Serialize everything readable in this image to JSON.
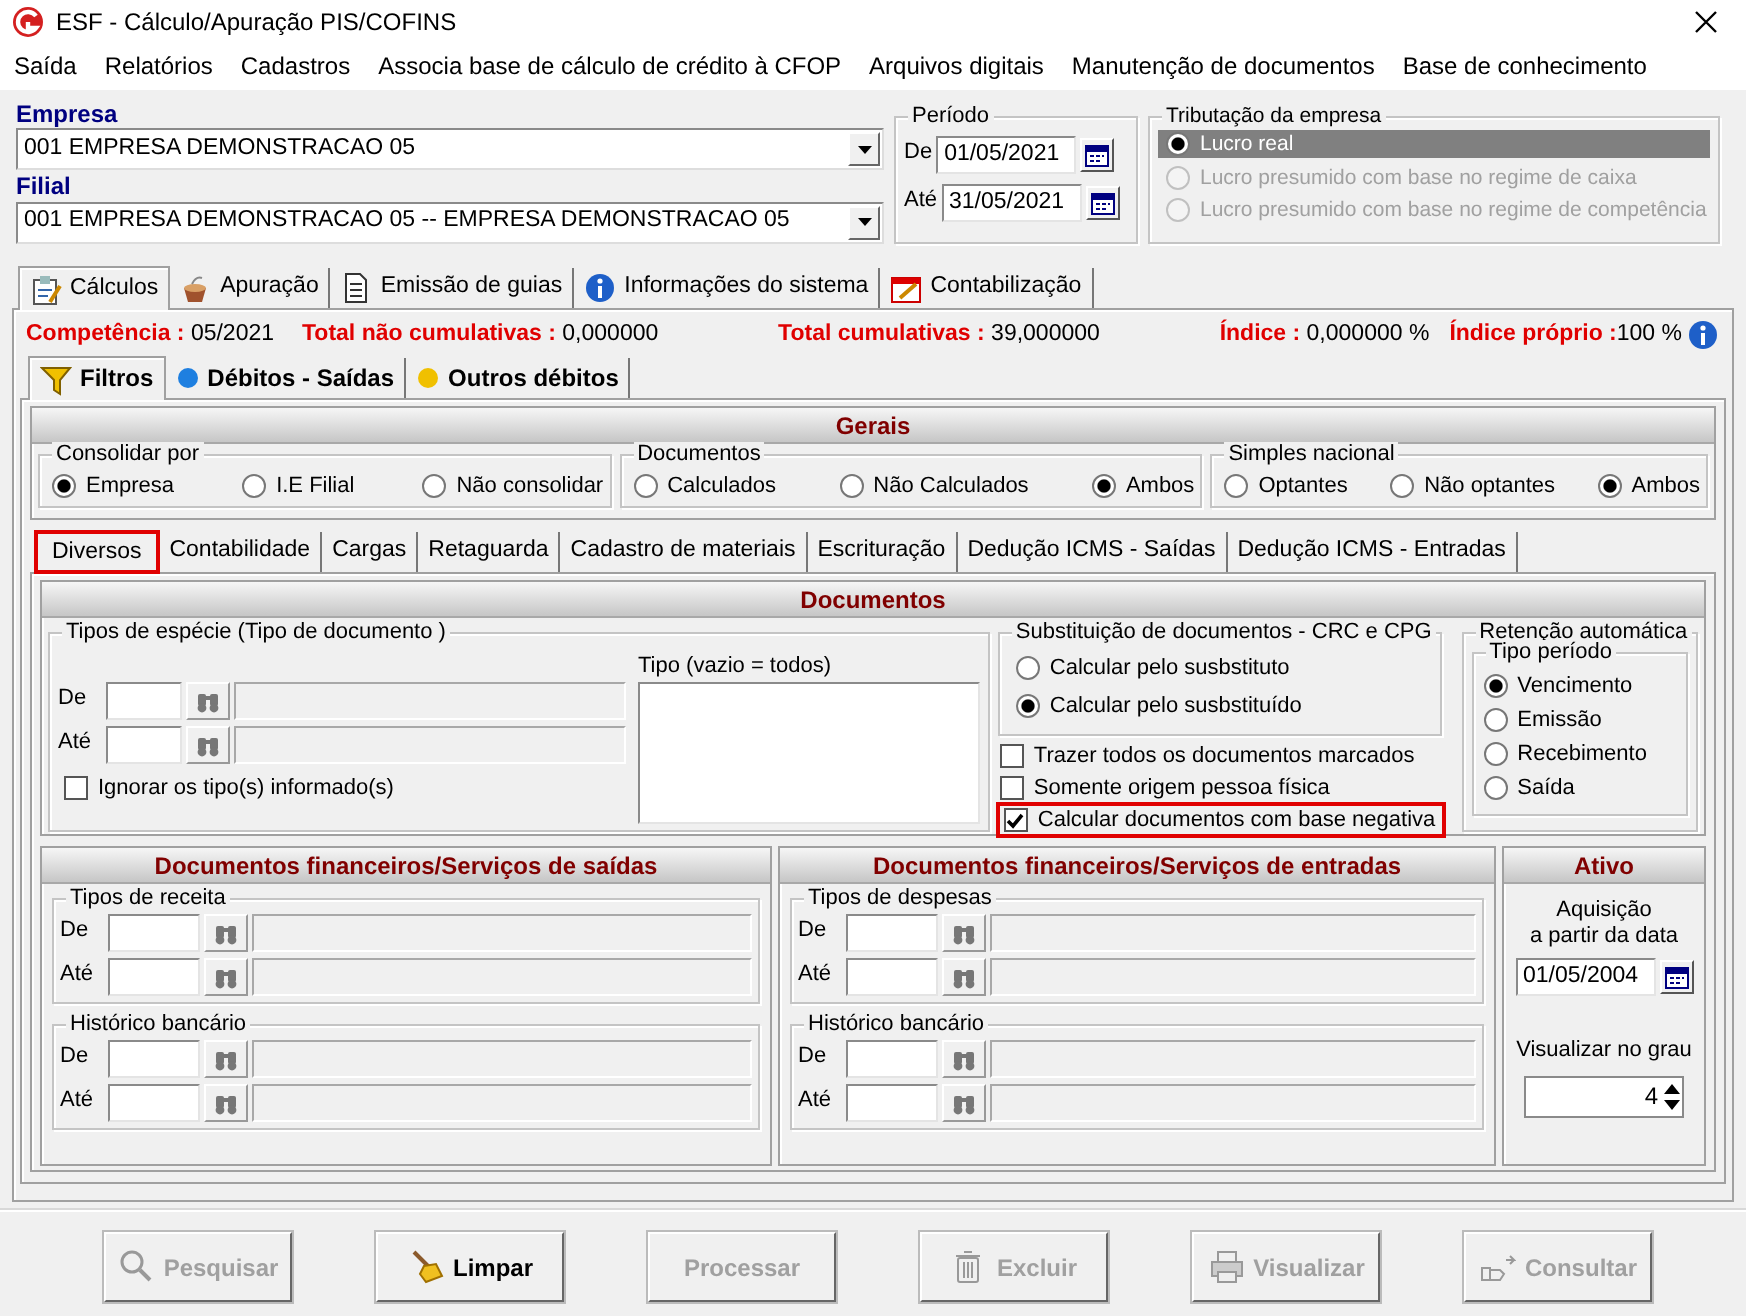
{
  "window": {
    "title": "ESF - Cálculo/Apuração PIS/COFINS"
  },
  "menu": [
    "Saída",
    "Relatórios",
    "Cadastros",
    "Associa base de cálculo de crédito à CFOP",
    "Arquivos digitais",
    "Manutenção de documentos",
    "Base de conhecimento"
  ],
  "empresa": {
    "label": "Empresa",
    "value": "001 EMPRESA DEMONSTRACAO 05"
  },
  "filial": {
    "label": "Filial",
    "value": "001 EMPRESA DEMONSTRACAO 05 -- EMPRESA DEMONSTRACAO 05"
  },
  "periodo": {
    "title": "Período",
    "fields": [
      {
        "label": "De",
        "value": "01/05/2021"
      },
      {
        "label": "Até",
        "value": "31/05/2021"
      }
    ]
  },
  "tributacao": {
    "title": "Tributação da empresa",
    "options": [
      {
        "label": "Lucro real",
        "selected": true,
        "disabled": false
      },
      {
        "label": "Lucro presumido com base no regime de caixa",
        "selected": false,
        "disabled": true
      },
      {
        "label": "Lucro presumido com base no regime de competência",
        "selected": false,
        "disabled": true
      }
    ]
  },
  "main_tabs": [
    {
      "label": "Cálculos",
      "selected": true,
      "kind": "clipboard"
    },
    {
      "label": "Apuração",
      "selected": false,
      "kind": "cup"
    },
    {
      "label": "Emissão de guias",
      "selected": false,
      "kind": "document"
    },
    {
      "label": "Informações do sistema",
      "selected": false,
      "kind": "info"
    },
    {
      "label": "Contabilização",
      "selected": false,
      "kind": "calendar"
    }
  ],
  "summary": [
    {
      "label": "Competência :",
      "value": " 05/2021"
    },
    {
      "label": "Total não cumulativas :",
      "value": " 0,000000"
    },
    {
      "label": "Total cumulativas :",
      "value": " 39,000000"
    },
    {
      "label": "Índice :",
      "value": " 0,000000 %"
    },
    {
      "label": "Índice próprio :",
      "value": "100 %"
    }
  ],
  "sub_tabs": [
    {
      "label": "Filtros",
      "selected": true,
      "kind": "funnel"
    },
    {
      "label": "Débitos - Saídas",
      "selected": false,
      "kind": "dot",
      "color": "#1e7fe0"
    },
    {
      "label": "Outros débitos",
      "selected": false,
      "kind": "dot",
      "color": "#f0c000"
    }
  ],
  "gerais": {
    "title": "Gerais",
    "groups": [
      {
        "title": "Consolidar por",
        "options": [
          {
            "label": "Empresa",
            "selected": true
          },
          {
            "label": "I.E Filial",
            "selected": false
          },
          {
            "label": "Não consolidar",
            "selected": false
          }
        ]
      },
      {
        "title": "Documentos",
        "options": [
          {
            "label": "Calculados",
            "selected": false
          },
          {
            "label": "Não Calculados",
            "selected": false
          },
          {
            "label": "Ambos",
            "selected": true
          }
        ]
      },
      {
        "title": "Simples nacional",
        "options": [
          {
            "label": "Optantes",
            "selected": false
          },
          {
            "label": "Não optantes",
            "selected": false
          },
          {
            "label": "Ambos",
            "selected": true
          }
        ]
      }
    ]
  },
  "inner_tabs": [
    {
      "label": "Diversos",
      "selected": true,
      "highlighted": true
    },
    {
      "label": "Contabilidade",
      "selected": false,
      "highlighted": false
    },
    {
      "label": "Cargas",
      "selected": false,
      "highlighted": false
    },
    {
      "label": "Retaguarda",
      "selected": false,
      "highlighted": false
    },
    {
      "label": "Cadastro de materiais",
      "selected": false,
      "highlighted": false
    },
    {
      "label": "Escrituração",
      "selected": false,
      "highlighted": false
    },
    {
      "label": "Dedução ICMS - Saídas",
      "selected": false,
      "highlighted": false
    },
    {
      "label": "Dedução ICMS - Entradas",
      "selected": false,
      "highlighted": false
    }
  ],
  "documentos": {
    "title": "Documentos",
    "tipos": {
      "title": "Tipos de espécie (Tipo de documento )",
      "rows": [
        {
          "label": "De"
        },
        {
          "label": "Até"
        }
      ],
      "ignorar": {
        "label": "Ignorar os tipo(s) informado(s)",
        "checked": false
      },
      "tipo_label": "Tipo (vazio = todos)"
    },
    "substituicao": {
      "title": "Substituição de documentos  - CRC e CPG",
      "options": [
        {
          "label": "Calcular pelo susbstituto",
          "selected": false
        },
        {
          "label": "Calcular pelo susbstituído",
          "selected": true
        }
      ]
    },
    "checks": [
      {
        "label": "Trazer todos os documentos marcados",
        "checked": false,
        "highlighted": false
      },
      {
        "label": "Somente origem pessoa física",
        "checked": false,
        "highlighted": false
      },
      {
        "label": "Calcular documentos com base negativa",
        "checked": true,
        "highlighted": true
      }
    ],
    "retencao": {
      "title": "Retenção automática",
      "subtitle": "Tipo período",
      "options": [
        {
          "label": "Vencimento",
          "selected": true
        },
        {
          "label": "Emissão",
          "selected": false
        },
        {
          "label": "Recebimento",
          "selected": false
        },
        {
          "label": "Saída",
          "selected": false
        }
      ]
    }
  },
  "saidas": {
    "title": "Documentos financeiros/Serviços de saídas",
    "groups": [
      {
        "title": "Tipos de receita",
        "rows": [
          {
            "label": "De"
          },
          {
            "label": "Até"
          }
        ]
      },
      {
        "title": "Histórico bancário",
        "rows": [
          {
            "label": "De"
          },
          {
            "label": "Até"
          }
        ]
      }
    ]
  },
  "entradas": {
    "title": "Documentos financeiros/Serviços de entradas",
    "groups": [
      {
        "title": "Tipos de despesas",
        "rows": [
          {
            "label": "De"
          },
          {
            "label": "Até"
          }
        ]
      },
      {
        "title": "Histórico bancário",
        "rows": [
          {
            "label": "De"
          },
          {
            "label": "Até"
          }
        ]
      }
    ]
  },
  "ativo": {
    "title": "Ativo",
    "aquisicao": [
      "Aquisição",
      "a partir da data"
    ],
    "date": "01/05/2004",
    "grau_label": "Visualizar no grau",
    "grau": "4"
  },
  "buttons": [
    {
      "label": "Pesquisar",
      "disabled": true,
      "kind": "search"
    },
    {
      "label": "Limpar",
      "disabled": false,
      "kind": "broom"
    },
    {
      "label": "Processar",
      "disabled": true,
      "kind": "none"
    },
    {
      "label": "Excluir",
      "disabled": true,
      "kind": "trash"
    },
    {
      "label": "Visualizar",
      "disabled": true,
      "kind": "printer"
    },
    {
      "label": "Consultar",
      "disabled": true,
      "kind": "consult"
    }
  ]
}
